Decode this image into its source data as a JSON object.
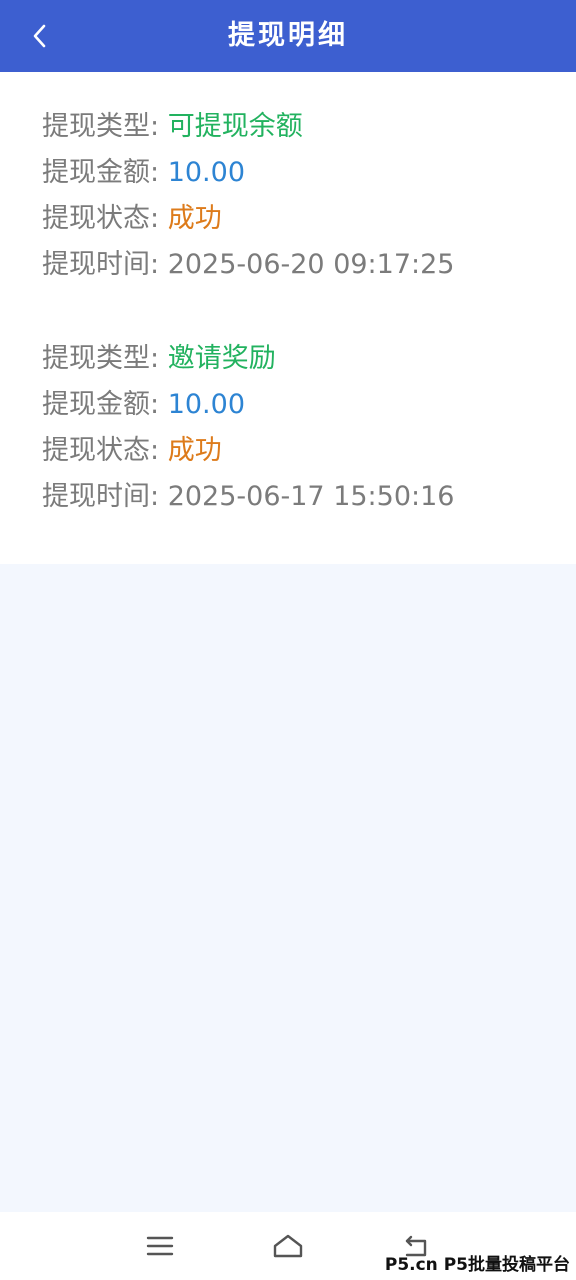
{
  "header": {
    "title": "提现明细",
    "back_icon": "chevron-left-icon"
  },
  "records": [
    {
      "type_label": "提现类型:",
      "type_value": "可提现余额",
      "amount_label": "提现金额:",
      "amount_value": "10.00",
      "status_label": "提现状态:",
      "status_value": "成功",
      "time_label": "提现时间:",
      "time_value": "2025-06-20 09:17:25"
    },
    {
      "type_label": "提现类型:",
      "type_value": "邀请奖励",
      "amount_label": "提现金额:",
      "amount_value": "10.00",
      "status_label": "提现状态:",
      "status_value": "成功",
      "time_label": "提现时间:",
      "time_value": "2025-06-17 15:50:16"
    }
  ],
  "colors": {
    "header_bg": "#3d5fd0",
    "type_value": "#22b25f",
    "amount_value": "#2d84d3",
    "status_value": "#dd7b1b",
    "label": "#7b7b7b",
    "page_bg": "#f3f7fe"
  },
  "navbar": {
    "icons": [
      "menu-icon",
      "home-icon",
      "back-icon"
    ]
  },
  "watermark": "P5.cn P5批量投稿平台"
}
